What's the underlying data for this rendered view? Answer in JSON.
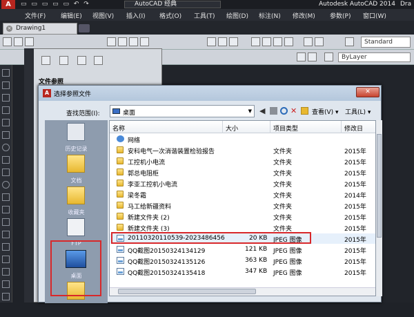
{
  "titlebar": {
    "logo": "A",
    "workspace": "AutoCAD 经典",
    "app_title": "Autodesk AutoCAD 2014",
    "app_title_right": "Dra"
  },
  "menubar": [
    "文件(F)",
    "编辑(E)",
    "视图(V)",
    "插入(I)",
    "格式(O)",
    "工具(T)",
    "绘图(D)",
    "标注(N)",
    "修改(M)",
    "参数(P)",
    "窗口(W)"
  ],
  "doc_tab": {
    "label": "Drawing1"
  },
  "toolbar": {
    "text_style": "Standard",
    "layer": "ByLayer"
  },
  "palette": {
    "title": "文件参照"
  },
  "dialog": {
    "title": "选择参照文件",
    "lookin_label": "查找范围(I):",
    "lookin_value": "桌面",
    "view_label": "查看(V)",
    "tools_label": "工具(L)",
    "places": [
      {
        "label": "历史记录",
        "icon": "history-icon"
      },
      {
        "label": "文档",
        "icon": "documents-icon"
      },
      {
        "label": "收藏夹",
        "icon": "favorites-icon"
      },
      {
        "label": "FTP",
        "icon": "ftp-icon"
      },
      {
        "label": "桌面",
        "icon": "desktop-icon"
      },
      {
        "label": "",
        "icon": "folder-icon"
      }
    ],
    "columns": {
      "name": "名称",
      "size": "大小",
      "type": "项目类型",
      "modified": "修改日"
    },
    "files": [
      {
        "icon": "network-icon",
        "name": "网络",
        "size": "",
        "type": "",
        "date": ""
      },
      {
        "icon": "folder-icon",
        "name": "安科电气一次消谐装置检验报告",
        "size": "",
        "type": "文件夹",
        "date": "2015年"
      },
      {
        "icon": "folder-icon",
        "name": "工控机小电流",
        "size": "",
        "type": "文件夹",
        "date": "2015年"
      },
      {
        "icon": "folder-icon",
        "name": "郭总电阻柜",
        "size": "",
        "type": "文件夹",
        "date": "2015年"
      },
      {
        "icon": "folder-icon",
        "name": "李亚工控机小电流",
        "size": "",
        "type": "文件夹",
        "date": "2015年"
      },
      {
        "icon": "folder-icon",
        "name": "梁冬霜",
        "size": "",
        "type": "文件夹",
        "date": "2014年"
      },
      {
        "icon": "folder-icon",
        "name": "马工给新疆资料",
        "size": "",
        "type": "文件夹",
        "date": "2015年"
      },
      {
        "icon": "folder-icon",
        "name": "新建文件夹 (2)",
        "size": "",
        "type": "文件夹",
        "date": "2015年"
      },
      {
        "icon": "folder-icon",
        "name": "新建文件夹 (3)",
        "size": "",
        "type": "文件夹",
        "date": "2015年"
      },
      {
        "icon": "image-icon",
        "name": "20110320110539-2023486456",
        "size": "20 KB",
        "type": "JPEG 图像",
        "date": "2015年"
      },
      {
        "icon": "image-icon",
        "name": "QQ截图20150324134129",
        "size": "121 KB",
        "type": "JPEG 图像",
        "date": "2015年"
      },
      {
        "icon": "image-icon",
        "name": "QQ截图20150324135126",
        "size": "363 KB",
        "type": "JPEG 图像",
        "date": "2015年"
      },
      {
        "icon": "image-icon",
        "name": "QQ截图20150324135418",
        "size": "347 KB",
        "type": "JPEG 图像",
        "date": "2015年"
      }
    ]
  }
}
